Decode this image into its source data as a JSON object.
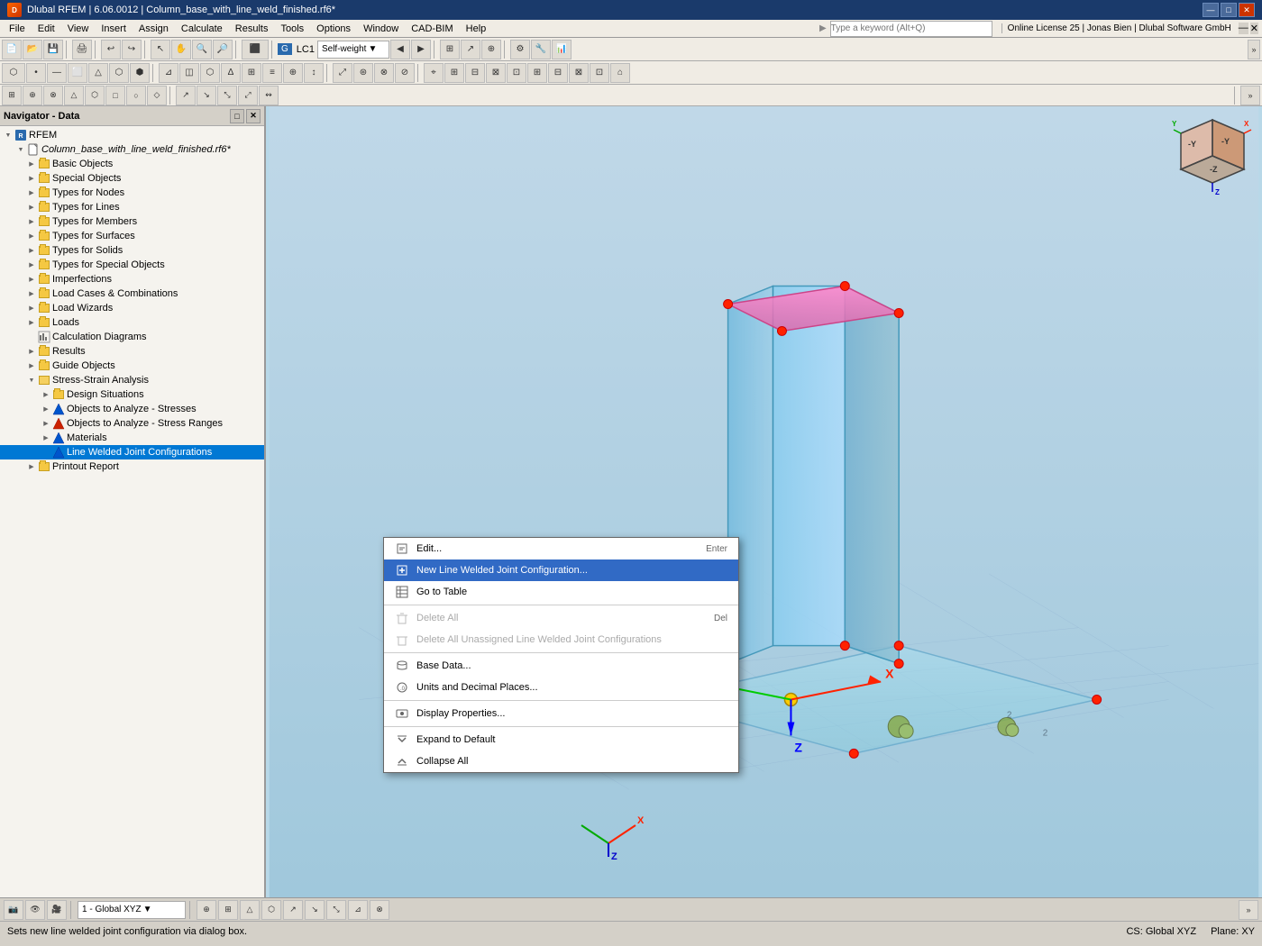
{
  "app": {
    "title": "Dlubal RFEM | 6.06.0012 | Column_base_with_line_weld_finished.rf6*",
    "icon": "D"
  },
  "titlebar": {
    "controls": [
      "—",
      "□",
      "✕"
    ]
  },
  "menubar": {
    "items": [
      "File",
      "Edit",
      "View",
      "Insert",
      "Assign",
      "Calculate",
      "Results",
      "Tools",
      "Options",
      "Window",
      "CAD-BIM",
      "Help"
    ]
  },
  "searchbar": {
    "placeholder": "Type a keyword (Alt+Q)",
    "license_info": "Online License 25 | Jonas Bien | Dlubal Software GmbH"
  },
  "toolbar1": {
    "lc_badge": "G",
    "lc_number": "LC1",
    "lc_name": "Self-weight"
  },
  "navigator": {
    "title": "Navigator - Data",
    "root": "RFEM",
    "filename": "Column_base_with_line_weld_finished.rf6*",
    "items": [
      {
        "id": "basic-objects",
        "label": "Basic Objects",
        "level": 1,
        "expanded": false,
        "hasChildren": true
      },
      {
        "id": "special-objects",
        "label": "Special Objects",
        "level": 1,
        "expanded": false,
        "hasChildren": true
      },
      {
        "id": "types-nodes",
        "label": "Types for Nodes",
        "level": 1,
        "expanded": false,
        "hasChildren": true
      },
      {
        "id": "types-lines",
        "label": "Types for Lines",
        "level": 1,
        "expanded": false,
        "hasChildren": true
      },
      {
        "id": "types-members",
        "label": "Types for Members",
        "level": 1,
        "expanded": false,
        "hasChildren": true
      },
      {
        "id": "types-surfaces",
        "label": "Types for Surfaces",
        "level": 1,
        "expanded": false,
        "hasChildren": true
      },
      {
        "id": "types-solids",
        "label": "Types for Solids",
        "level": 1,
        "expanded": false,
        "hasChildren": true
      },
      {
        "id": "types-special",
        "label": "Types for Special Objects",
        "level": 1,
        "expanded": false,
        "hasChildren": true
      },
      {
        "id": "imperfections",
        "label": "Imperfections",
        "level": 1,
        "expanded": false,
        "hasChildren": true
      },
      {
        "id": "load-cases",
        "label": "Load Cases & Combinations",
        "level": 1,
        "expanded": false,
        "hasChildren": true
      },
      {
        "id": "load-wizards",
        "label": "Load Wizards",
        "level": 1,
        "expanded": false,
        "hasChildren": true
      },
      {
        "id": "loads",
        "label": "Loads",
        "level": 1,
        "expanded": false,
        "hasChildren": true
      },
      {
        "id": "calc-diagrams",
        "label": "Calculation Diagrams",
        "level": 1,
        "expanded": false,
        "hasChildren": false
      },
      {
        "id": "results",
        "label": "Results",
        "level": 1,
        "expanded": false,
        "hasChildren": true
      },
      {
        "id": "guide-objects",
        "label": "Guide Objects",
        "level": 1,
        "expanded": false,
        "hasChildren": true
      },
      {
        "id": "stress-strain",
        "label": "Stress-Strain Analysis",
        "level": 1,
        "expanded": true,
        "hasChildren": true
      },
      {
        "id": "design-situations",
        "label": "Design Situations",
        "level": 2,
        "expanded": false,
        "hasChildren": true,
        "iconType": "folder"
      },
      {
        "id": "objects-stresses",
        "label": "Objects to Analyze - Stresses",
        "level": 2,
        "expanded": false,
        "hasChildren": true,
        "iconType": "analysis-blue"
      },
      {
        "id": "objects-stress-ranges",
        "label": "Objects to Analyze - Stress Ranges",
        "level": 2,
        "expanded": false,
        "hasChildren": true,
        "iconType": "analysis-red"
      },
      {
        "id": "materials",
        "label": "Materials",
        "level": 2,
        "expanded": false,
        "hasChildren": true,
        "iconType": "analysis-blue"
      },
      {
        "id": "line-welded",
        "label": "Line Welded Joint Configurations",
        "level": 2,
        "expanded": false,
        "hasChildren": false,
        "iconType": "analysis-blue",
        "selected": true
      },
      {
        "id": "printout-report",
        "label": "Printout Report",
        "level": 1,
        "expanded": false,
        "hasChildren": true
      }
    ]
  },
  "context_menu": {
    "visible": true,
    "items": [
      {
        "id": "edit",
        "label": "Edit...",
        "shortcut": "Enter",
        "icon": "edit",
        "disabled": false,
        "highlighted": false
      },
      {
        "id": "new-line-welded",
        "label": "New Line Welded Joint Configuration...",
        "shortcut": "",
        "icon": "new-config",
        "disabled": false,
        "highlighted": true
      },
      {
        "id": "go-to-table",
        "label": "Go to Table",
        "shortcut": "",
        "icon": "table",
        "disabled": false,
        "highlighted": false
      },
      {
        "id": "sep1",
        "type": "separator"
      },
      {
        "id": "delete-all",
        "label": "Delete All",
        "shortcut": "Del",
        "icon": "delete",
        "disabled": true,
        "highlighted": false
      },
      {
        "id": "delete-unassigned",
        "label": "Delete All Unassigned Line Welded Joint Configurations",
        "shortcut": "",
        "icon": "delete",
        "disabled": true,
        "highlighted": false
      },
      {
        "id": "sep2",
        "type": "separator"
      },
      {
        "id": "base-data",
        "label": "Base Data...",
        "shortcut": "",
        "icon": "base-data",
        "disabled": false,
        "highlighted": false
      },
      {
        "id": "units",
        "label": "Units and Decimal Places...",
        "shortcut": "",
        "icon": "units",
        "disabled": false,
        "highlighted": false
      },
      {
        "id": "sep3",
        "type": "separator"
      },
      {
        "id": "display-props",
        "label": "Display Properties...",
        "shortcut": "",
        "icon": "display",
        "disabled": false,
        "highlighted": false
      },
      {
        "id": "sep4",
        "type": "separator"
      },
      {
        "id": "expand-default",
        "label": "Expand to Default",
        "shortcut": "",
        "icon": "expand",
        "disabled": false,
        "highlighted": false
      },
      {
        "id": "collapse-all",
        "label": "Collapse All",
        "shortcut": "",
        "icon": "collapse",
        "disabled": false,
        "highlighted": false
      }
    ]
  },
  "statusbar": {
    "left": "Sets new line welded joint configuration via dialog box.",
    "coord_system": "1 - Global XYZ",
    "cs": "CS: Global XYZ",
    "plane": "Plane: XY"
  },
  "viewport": {
    "has_3d_model": true
  }
}
